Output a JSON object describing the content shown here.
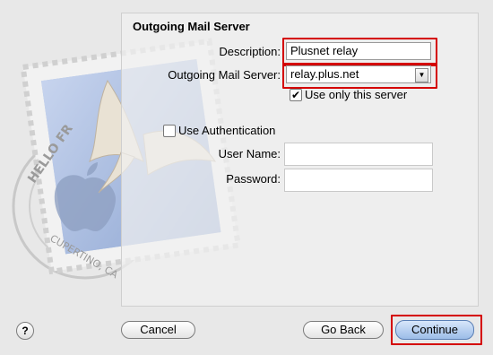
{
  "panel": {
    "title": "Outgoing Mail Server"
  },
  "form": {
    "description_label": "Description:",
    "description_value": "Plusnet relay",
    "server_label": "Outgoing Mail Server:",
    "server_value": "relay.plus.net",
    "use_only_label": "Use only this server",
    "use_only_checked": true,
    "auth_label": "Use Authentication",
    "auth_checked": false,
    "username_label": "User Name:",
    "username_value": "",
    "password_label": "Password:",
    "password_value": ""
  },
  "stamp": {
    "text_top": "HELLO FR",
    "text_bottom": "CUPERTINO, CA"
  },
  "buttons": {
    "help": "?",
    "cancel": "Cancel",
    "go_back": "Go Back",
    "continue": "Continue"
  },
  "colors": {
    "highlight": "#d40000",
    "stamp_blue": "#9fb4d8"
  },
  "icons": {
    "combo_arrow": "chevron-down-icon",
    "checkmark": "checkmark-icon"
  }
}
